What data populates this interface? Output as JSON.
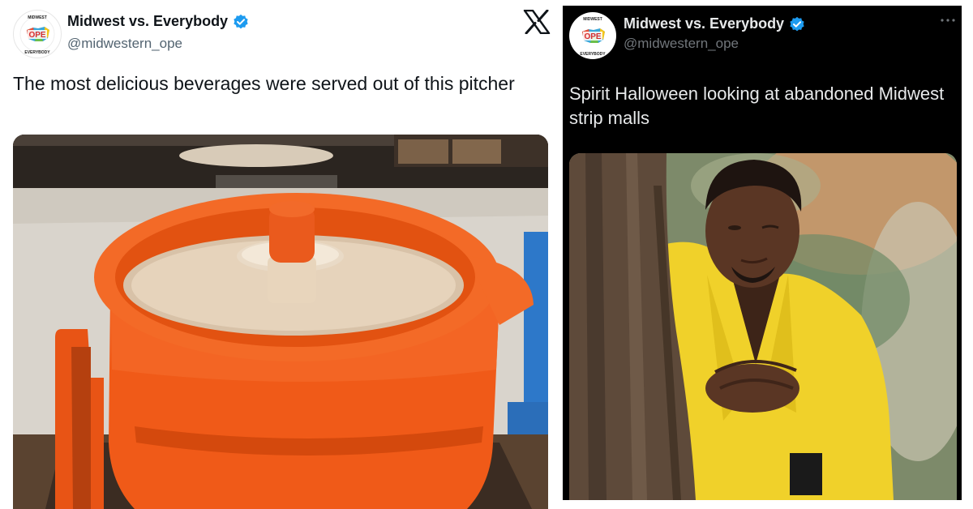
{
  "left_tweet": {
    "display_name": "Midwest vs. Everybody",
    "handle": "@midwestern_ope",
    "text": "The most delicious beverages were served out of this pitcher",
    "avatar_logo_text": "OPE",
    "avatar_ring_text": "MIDWEST vs EVERYBODY",
    "media_icon": "orange-plastic-pitcher-photo",
    "brand_icon": "x-logo-icon"
  },
  "right_tweet": {
    "display_name": "Midwest vs. Everybody",
    "handle": "@midwestern_ope",
    "text": "Spirit Halloween looking at abandoned Midwest strip malls",
    "avatar_logo_text": "OPE",
    "avatar_ring_text": "MIDWEST vs EVERYBODY",
    "media_icon": "man-in-yellow-suit-behind-tree-photo",
    "menu_icon": "more-dots-icon"
  },
  "colors": {
    "light_bg": "#ffffff",
    "dark_bg": "#000000",
    "verified_blue": "#1d9bf0",
    "pitcher_orange": "#ef5a16",
    "suit_yellow": "#f0d12a"
  }
}
